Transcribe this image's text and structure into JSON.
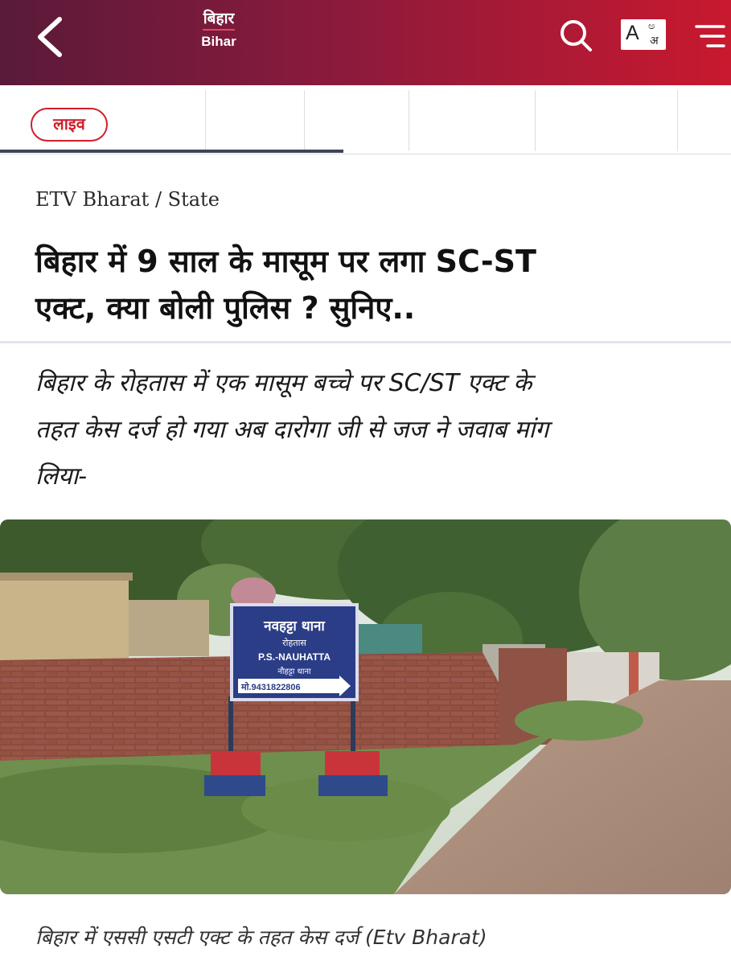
{
  "header": {
    "back_icon": "chevron-left-icon",
    "brand_hindi": "बिहार",
    "brand_english": "Bihar",
    "search_icon": "search-icon",
    "language_toggle": {
      "latin": "A",
      "script_top": "ಅ",
      "script_bottom": "अ"
    },
    "menu_icon": "hamburger-menu-icon",
    "gradient_colors": [
      "#5a1a3a",
      "#c8192f"
    ]
  },
  "tabs": {
    "live_label": "लाइव",
    "live_color": "#d11d2b"
  },
  "article": {
    "breadcrumb": "ETV Bharat / State",
    "headline_line1": "बिहार में 9 साल के मासूम पर लगा SC-ST",
    "headline_line2": "एक्ट, क्या बोली पुलिस ? सुनिए..",
    "summary_line1": "बिहार के रोहतास में एक मासूम बच्चे पर SC/ST एक्ट के",
    "summary_line2": "तहत केस दर्ज हो गया अब दारोगा जी से जज ने जवाब मांग",
    "summary_line3": "लिया-",
    "image": {
      "sign_line1": "नवहट्टा थाना",
      "sign_line2": "रोहतास",
      "sign_line3": "P.S.-NAUHATTA",
      "sign_line4": "नौहट्टा थाना",
      "sign_line5": "मो.9431822806"
    },
    "caption": "बिहार में एससी एसटी एक्ट के तहत केस दर्ज (Etv Bharat)"
  }
}
